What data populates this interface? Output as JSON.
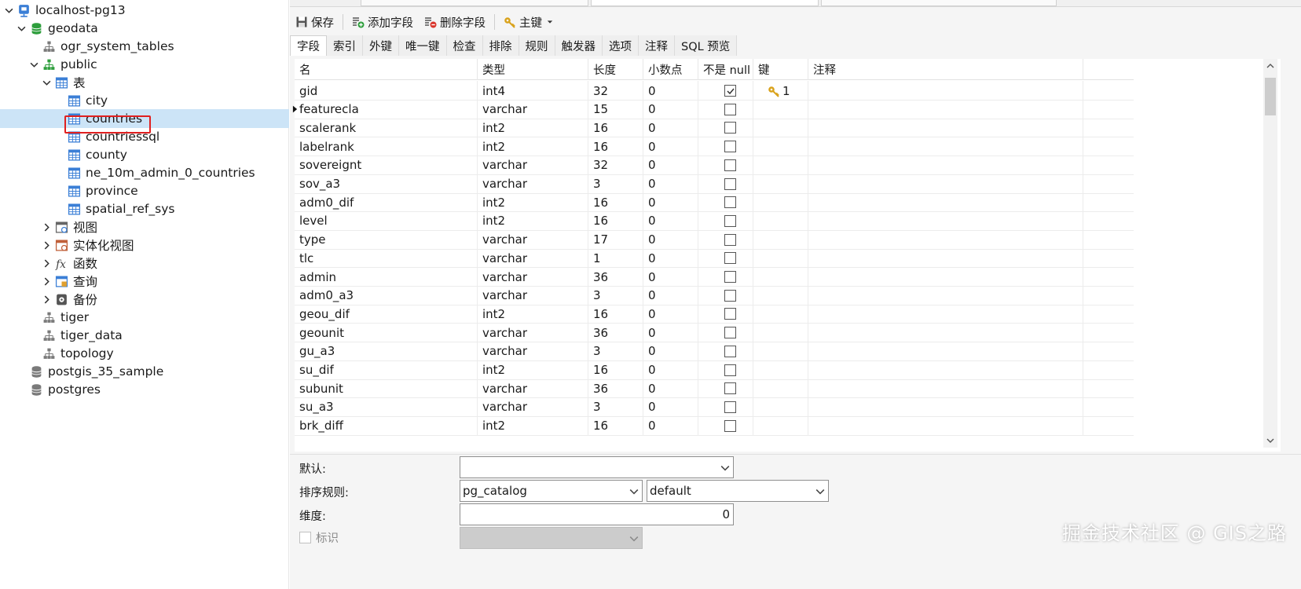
{
  "tree": {
    "connection": "localhost-pg13",
    "database": "geodata",
    "schema_ogr": "ogr_system_tables",
    "schema_public": "public",
    "folder_tables": "表",
    "tables": [
      "city",
      "countries",
      "countriessql",
      "county",
      "ne_10m_admin_0_countries",
      "province",
      "spatial_ref_sys"
    ],
    "selected_table": "countries",
    "folder_views": "视图",
    "folder_matviews": "实体化视图",
    "folder_functions": "函数",
    "folder_queries": "查询",
    "folder_backups": "备份",
    "schema_tiger": "tiger",
    "schema_tiger_data": "tiger_data",
    "schema_topology": "topology",
    "db_postgis_sample": "postgis_35_sample",
    "db_postgres": "postgres"
  },
  "toolbar": {
    "save": "保存",
    "add_field": "添加字段",
    "delete_field": "删除字段",
    "primary_key": "主键"
  },
  "subtabs": [
    "字段",
    "索引",
    "外键",
    "唯一键",
    "检查",
    "排除",
    "规则",
    "触发器",
    "选项",
    "注释",
    "SQL 预览"
  ],
  "grid": {
    "headers": [
      "名",
      "类型",
      "长度",
      "小数点",
      "不是 null",
      "键",
      "注释"
    ],
    "rows": [
      {
        "name": "gid",
        "type": "int4",
        "length": "32",
        "decimals": "0",
        "not_null": true,
        "key": "1"
      },
      {
        "name": "featurecla",
        "type": "varchar",
        "length": "15",
        "decimals": "0",
        "not_null": false,
        "key": ""
      },
      {
        "name": "scalerank",
        "type": "int2",
        "length": "16",
        "decimals": "0",
        "not_null": false,
        "key": ""
      },
      {
        "name": "labelrank",
        "type": "int2",
        "length": "16",
        "decimals": "0",
        "not_null": false,
        "key": ""
      },
      {
        "name": "sovereignt",
        "type": "varchar",
        "length": "32",
        "decimals": "0",
        "not_null": false,
        "key": ""
      },
      {
        "name": "sov_a3",
        "type": "varchar",
        "length": "3",
        "decimals": "0",
        "not_null": false,
        "key": ""
      },
      {
        "name": "adm0_dif",
        "type": "int2",
        "length": "16",
        "decimals": "0",
        "not_null": false,
        "key": ""
      },
      {
        "name": "level",
        "type": "int2",
        "length": "16",
        "decimals": "0",
        "not_null": false,
        "key": ""
      },
      {
        "name": "type",
        "type": "varchar",
        "length": "17",
        "decimals": "0",
        "not_null": false,
        "key": ""
      },
      {
        "name": "tlc",
        "type": "varchar",
        "length": "1",
        "decimals": "0",
        "not_null": false,
        "key": ""
      },
      {
        "name": "admin",
        "type": "varchar",
        "length": "36",
        "decimals": "0",
        "not_null": false,
        "key": ""
      },
      {
        "name": "adm0_a3",
        "type": "varchar",
        "length": "3",
        "decimals": "0",
        "not_null": false,
        "key": ""
      },
      {
        "name": "geou_dif",
        "type": "int2",
        "length": "16",
        "decimals": "0",
        "not_null": false,
        "key": ""
      },
      {
        "name": "geounit",
        "type": "varchar",
        "length": "36",
        "decimals": "0",
        "not_null": false,
        "key": ""
      },
      {
        "name": "gu_a3",
        "type": "varchar",
        "length": "3",
        "decimals": "0",
        "not_null": false,
        "key": ""
      },
      {
        "name": "su_dif",
        "type": "int2",
        "length": "16",
        "decimals": "0",
        "not_null": false,
        "key": ""
      },
      {
        "name": "subunit",
        "type": "varchar",
        "length": "36",
        "decimals": "0",
        "not_null": false,
        "key": ""
      },
      {
        "name": "su_a3",
        "type": "varchar",
        "length": "3",
        "decimals": "0",
        "not_null": false,
        "key": ""
      },
      {
        "name": "brk_diff",
        "type": "int2",
        "length": "16",
        "decimals": "0",
        "not_null": false,
        "key": ""
      }
    ]
  },
  "props": {
    "default_label": "默认:",
    "default_value": "",
    "collation_label": "排序规则:",
    "collation_schema": "pg_catalog",
    "collation_value": "default",
    "dimension_label": "维度:",
    "dimension_value": "0",
    "identity_label": "标识"
  },
  "watermark": "掘金技术社区 @ GIS之路",
  "colors": {
    "selection": "#cce4f7",
    "highlight_box": "#e02020",
    "key_icon": "#d9a21b",
    "db_icon": "#2e9e3c"
  }
}
